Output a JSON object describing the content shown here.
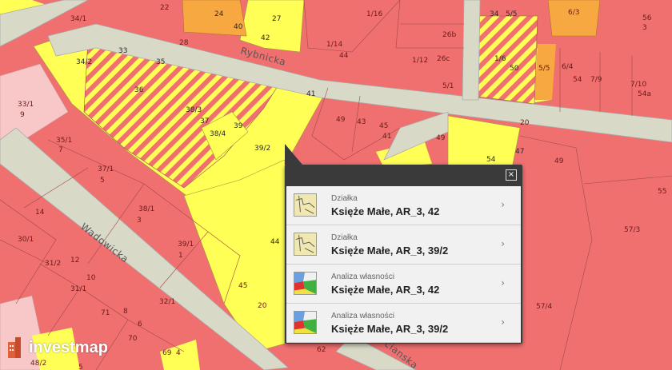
{
  "map": {
    "streets": {
      "rybnicka": "Rybnicka",
      "wadowicka": "Wadowicka",
      "bottom": "cianska"
    },
    "parcels": [
      "34/1",
      "22",
      "24",
      "40",
      "27",
      "42",
      "1/16",
      "56",
      "3",
      "28",
      "33",
      "35",
      "34/2",
      "1/14",
      "26b",
      "34",
      "5/5",
      "6/3",
      "44",
      "1/12",
      "26c",
      "1/6",
      "50",
      "6/4",
      "7/9",
      "54",
      "7/10",
      "54a",
      "5/1",
      "5/5",
      "33/1",
      "9",
      "36",
      "38/3",
      "37",
      "41",
      "49",
      "43",
      "45",
      "41",
      "20",
      "38/4",
      "39",
      "39/2",
      "49",
      "35/1",
      "7",
      "54",
      "47",
      "37/1",
      "5",
      "49",
      "14",
      "38/1",
      "3",
      "55",
      "30/1",
      "39/1",
      "1",
      "44",
      "57/3",
      "31/2",
      "12",
      "31/1",
      "10",
      "45",
      "32/1",
      "71",
      "8",
      "20",
      "57/4",
      "6",
      "70",
      "69",
      "4",
      "62",
      "48/2",
      "5"
    ],
    "colors": {
      "red": "#f07070",
      "yellow": "#ffff55",
      "orange": "#f8a840",
      "pink": "#f8c8c8",
      "road": "#d9d9c8"
    }
  },
  "popup": {
    "close": "×",
    "items": [
      {
        "type": "Działka",
        "name": "Księże Małe, AR_3, 42",
        "icon": "parcel-icon"
      },
      {
        "type": "Działka",
        "name": "Księże Małe, AR_3, 39/2",
        "icon": "parcel-icon"
      },
      {
        "type": "Analiza własności",
        "name": "Księże Małe, AR_3, 42",
        "icon": "ownership-map-icon"
      },
      {
        "type": "Analiza własności",
        "name": "Księże Małe, AR_3, 39/2",
        "icon": "ownership-map-icon"
      }
    ]
  },
  "logo": {
    "text": "investmap"
  }
}
